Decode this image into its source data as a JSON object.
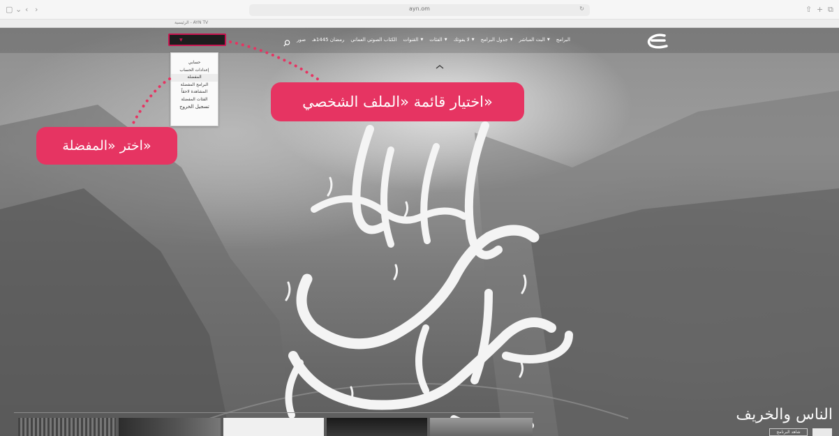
{
  "browser": {
    "url": "ayn.om",
    "tab_label": "الرئيسية - AYN TV"
  },
  "nav": {
    "items": [
      {
        "label": "البرامج",
        "caret": false
      },
      {
        "label": "البث المباشر",
        "caret": true
      },
      {
        "label": "جدول البرامج",
        "caret": true
      },
      {
        "label": "لا يفوتك",
        "caret": true
      },
      {
        "label": "الفئات",
        "caret": true
      },
      {
        "label": "القنوات",
        "caret": true
      },
      {
        "label": "الكتاب الصوتي العماني",
        "caret": false
      },
      {
        "label": "رمضان 1445هـ",
        "caret": false
      },
      {
        "label": "صور",
        "caret": false
      }
    ],
    "search_icon": "search-icon"
  },
  "profile_menu": {
    "caret": "▼",
    "items": [
      "حسابي",
      "إعدادات الحساب",
      "المفضلة",
      "البرامج المفضلة",
      "المشاهدة لاحقاً",
      "الفئات المفضلة",
      "تسجيل الخروج"
    ],
    "selected": "المفضلة"
  },
  "callouts": {
    "profile": "اختيار قائمة «الملف الشخصي»",
    "favorites": "اختر «المفضلة»"
  },
  "hero": {
    "show_title": "الناس والخريف",
    "button_label": "شاهد البرنامج"
  },
  "colors": {
    "accent": "#e63462",
    "highlight_border": "#c81450"
  }
}
